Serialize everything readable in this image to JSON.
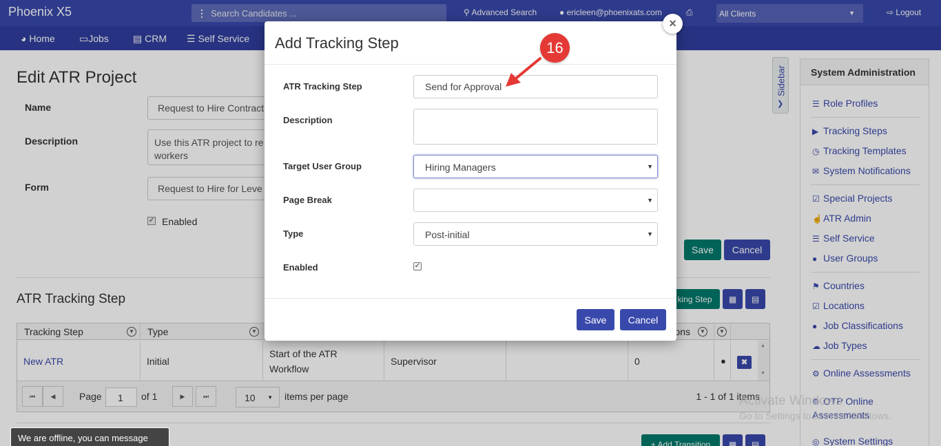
{
  "topbar": {
    "brand": "Phoenix X5",
    "search_placeholder": "Search Candidates ...",
    "advanced_search": "Advanced Search",
    "user_email": "ericleen@phoenixats.com",
    "client_select": "All Clients",
    "logout": "Logout"
  },
  "nav": {
    "home": "Home",
    "jobs": "Jobs",
    "crm": "CRM",
    "self_service": "Self Service"
  },
  "page": {
    "title": "Edit ATR Project",
    "name_label": "Name",
    "name_value": "Request to Hire Contract",
    "description_label": "Description",
    "description_line1": "Use this ATR project to re",
    "description_line2": "workers",
    "form_label": "Form",
    "form_value": "Request to Hire for Leve",
    "enabled_label": "Enabled",
    "save": "Save",
    "cancel": "Cancel",
    "section_title": "ATR Tracking Step",
    "add_step_button": "king Step",
    "add_transition_button": "Add Transition"
  },
  "grid": {
    "headers": {
      "tracking_step": "Tracking Step",
      "type": "Type",
      "actions": "ons"
    },
    "rows": [
      {
        "tracking_step": "New ATR",
        "type": "Initial",
        "description": "Start of the ATR Workflow",
        "group": "Supervisor",
        "count": "0"
      }
    ],
    "pager": {
      "page_label": "Page",
      "page_value": "1",
      "of_label": "of 1",
      "page_size": "10",
      "items_per_page": "items per page",
      "summary": "1 - 1 of 1 items"
    }
  },
  "sidebar": {
    "tab_label": "Sidebar",
    "panel_title": "System Administration",
    "items": [
      "Role Profiles",
      "Tracking Steps",
      "Tracking Templates",
      "System Notifications",
      "Special Projects",
      "ATR Admin",
      "Self Service",
      "User Groups",
      "Countries",
      "Locations",
      "Job Classifications",
      "Job Types",
      "Online Assessments",
      "OTP Online Assessments",
      "System Settings"
    ]
  },
  "modal": {
    "title": "Add Tracking Step",
    "step_label": "ATR Tracking Step",
    "step_value": "Send for Approval",
    "description_label": "Description",
    "target_group_label": "Target User Group",
    "target_group_value": "Hiring Managers",
    "page_break_label": "Page Break",
    "page_break_value": "",
    "type_label": "Type",
    "type_value": "Post-initial",
    "enabled_label": "Enabled",
    "enabled_checked": true,
    "save": "Save",
    "cancel": "Cancel"
  },
  "annotation": {
    "badge_number": "16",
    "color": "#e53935"
  },
  "offline_message": "We are offline, you can message us.",
  "watermark": {
    "line1": "Activate Windows",
    "line2": "Go to Settings to activate Windows."
  }
}
